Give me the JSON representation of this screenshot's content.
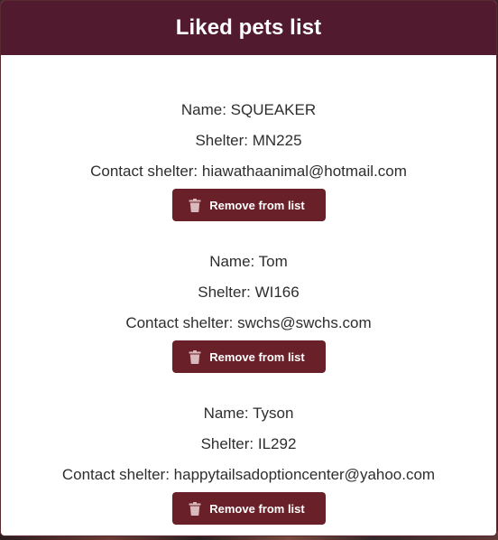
{
  "header": {
    "title": "Liked pets list"
  },
  "pets": [
    {
      "name": "Name: SQUEAKER",
      "shelter": "Shelter: MN225",
      "contact": "Contact shelter: hiawathaanimal@hotmail.com",
      "remove_label": "Remove from list"
    },
    {
      "name": "Name: Tom",
      "shelter": "Shelter: WI166",
      "contact": "Contact shelter: swchs@swchs.com",
      "remove_label": "Remove from list"
    },
    {
      "name": "Name: Tyson",
      "shelter": "Shelter: IL292",
      "contact": "Contact shelter: happytailsadoptioncenter@yahoo.com",
      "remove_label": "Remove from list"
    }
  ],
  "icons": {
    "remove": "trash-icon"
  },
  "colors": {
    "header_bg": "#521a2f",
    "button_bg": "#6a2028",
    "text": "#2e2e2e"
  }
}
